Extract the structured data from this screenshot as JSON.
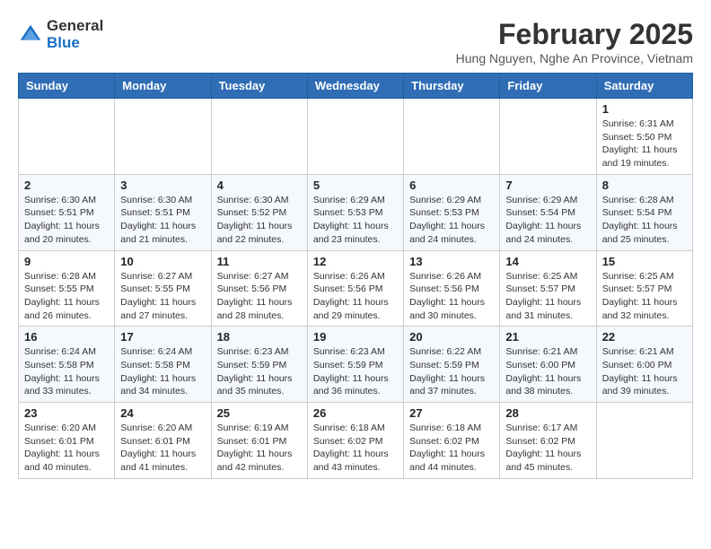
{
  "header": {
    "logo_line1": "General",
    "logo_line2": "Blue",
    "month_year": "February 2025",
    "location": "Hung Nguyen, Nghe An Province, Vietnam"
  },
  "days_of_week": [
    "Sunday",
    "Monday",
    "Tuesday",
    "Wednesday",
    "Thursday",
    "Friday",
    "Saturday"
  ],
  "weeks": [
    [
      {
        "day": "",
        "info": ""
      },
      {
        "day": "",
        "info": ""
      },
      {
        "day": "",
        "info": ""
      },
      {
        "day": "",
        "info": ""
      },
      {
        "day": "",
        "info": ""
      },
      {
        "day": "",
        "info": ""
      },
      {
        "day": "1",
        "info": "Sunrise: 6:31 AM\nSunset: 5:50 PM\nDaylight: 11 hours and 19 minutes."
      }
    ],
    [
      {
        "day": "2",
        "info": "Sunrise: 6:30 AM\nSunset: 5:51 PM\nDaylight: 11 hours and 20 minutes."
      },
      {
        "day": "3",
        "info": "Sunrise: 6:30 AM\nSunset: 5:51 PM\nDaylight: 11 hours and 21 minutes."
      },
      {
        "day": "4",
        "info": "Sunrise: 6:30 AM\nSunset: 5:52 PM\nDaylight: 11 hours and 22 minutes."
      },
      {
        "day": "5",
        "info": "Sunrise: 6:29 AM\nSunset: 5:53 PM\nDaylight: 11 hours and 23 minutes."
      },
      {
        "day": "6",
        "info": "Sunrise: 6:29 AM\nSunset: 5:53 PM\nDaylight: 11 hours and 24 minutes."
      },
      {
        "day": "7",
        "info": "Sunrise: 6:29 AM\nSunset: 5:54 PM\nDaylight: 11 hours and 24 minutes."
      },
      {
        "day": "8",
        "info": "Sunrise: 6:28 AM\nSunset: 5:54 PM\nDaylight: 11 hours and 25 minutes."
      }
    ],
    [
      {
        "day": "9",
        "info": "Sunrise: 6:28 AM\nSunset: 5:55 PM\nDaylight: 11 hours and 26 minutes."
      },
      {
        "day": "10",
        "info": "Sunrise: 6:27 AM\nSunset: 5:55 PM\nDaylight: 11 hours and 27 minutes."
      },
      {
        "day": "11",
        "info": "Sunrise: 6:27 AM\nSunset: 5:56 PM\nDaylight: 11 hours and 28 minutes."
      },
      {
        "day": "12",
        "info": "Sunrise: 6:26 AM\nSunset: 5:56 PM\nDaylight: 11 hours and 29 minutes."
      },
      {
        "day": "13",
        "info": "Sunrise: 6:26 AM\nSunset: 5:56 PM\nDaylight: 11 hours and 30 minutes."
      },
      {
        "day": "14",
        "info": "Sunrise: 6:25 AM\nSunset: 5:57 PM\nDaylight: 11 hours and 31 minutes."
      },
      {
        "day": "15",
        "info": "Sunrise: 6:25 AM\nSunset: 5:57 PM\nDaylight: 11 hours and 32 minutes."
      }
    ],
    [
      {
        "day": "16",
        "info": "Sunrise: 6:24 AM\nSunset: 5:58 PM\nDaylight: 11 hours and 33 minutes."
      },
      {
        "day": "17",
        "info": "Sunrise: 6:24 AM\nSunset: 5:58 PM\nDaylight: 11 hours and 34 minutes."
      },
      {
        "day": "18",
        "info": "Sunrise: 6:23 AM\nSunset: 5:59 PM\nDaylight: 11 hours and 35 minutes."
      },
      {
        "day": "19",
        "info": "Sunrise: 6:23 AM\nSunset: 5:59 PM\nDaylight: 11 hours and 36 minutes."
      },
      {
        "day": "20",
        "info": "Sunrise: 6:22 AM\nSunset: 5:59 PM\nDaylight: 11 hours and 37 minutes."
      },
      {
        "day": "21",
        "info": "Sunrise: 6:21 AM\nSunset: 6:00 PM\nDaylight: 11 hours and 38 minutes."
      },
      {
        "day": "22",
        "info": "Sunrise: 6:21 AM\nSunset: 6:00 PM\nDaylight: 11 hours and 39 minutes."
      }
    ],
    [
      {
        "day": "23",
        "info": "Sunrise: 6:20 AM\nSunset: 6:01 PM\nDaylight: 11 hours and 40 minutes."
      },
      {
        "day": "24",
        "info": "Sunrise: 6:20 AM\nSunset: 6:01 PM\nDaylight: 11 hours and 41 minutes."
      },
      {
        "day": "25",
        "info": "Sunrise: 6:19 AM\nSunset: 6:01 PM\nDaylight: 11 hours and 42 minutes."
      },
      {
        "day": "26",
        "info": "Sunrise: 6:18 AM\nSunset: 6:02 PM\nDaylight: 11 hours and 43 minutes."
      },
      {
        "day": "27",
        "info": "Sunrise: 6:18 AM\nSunset: 6:02 PM\nDaylight: 11 hours and 44 minutes."
      },
      {
        "day": "28",
        "info": "Sunrise: 6:17 AM\nSunset: 6:02 PM\nDaylight: 11 hours and 45 minutes."
      },
      {
        "day": "",
        "info": ""
      }
    ]
  ]
}
